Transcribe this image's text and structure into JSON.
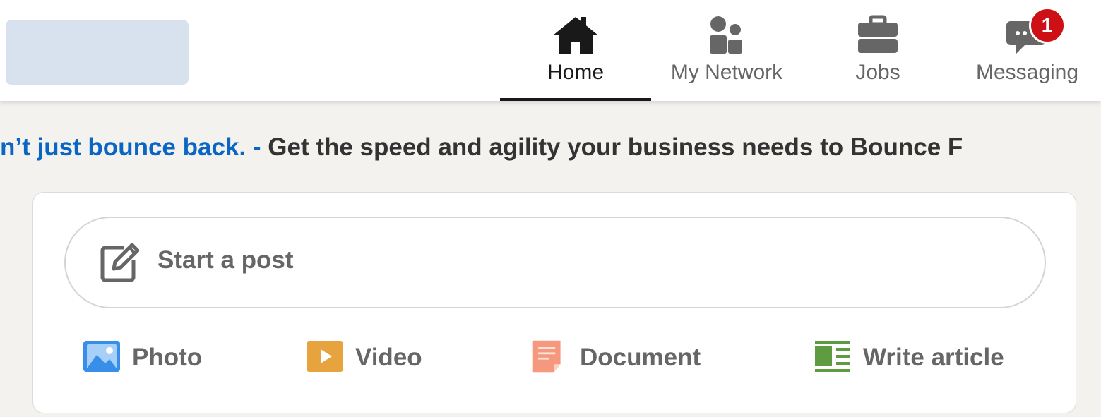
{
  "nav": {
    "items": [
      {
        "label": "Home",
        "icon": "home-icon",
        "active": true
      },
      {
        "label": "My Network",
        "icon": "people-icon",
        "active": false
      },
      {
        "label": "Jobs",
        "icon": "briefcase-icon",
        "active": false
      },
      {
        "label": "Messaging",
        "icon": "chat-icon",
        "active": false,
        "badge": "1"
      }
    ]
  },
  "ad": {
    "link_text": "n’t just bounce back.",
    "separator": " - ",
    "body_text": "Get the speed and agility your business needs to Bounce F"
  },
  "share_box": {
    "start_post_label": "Start a post",
    "actions": [
      {
        "label": "Photo",
        "icon": "photo-icon",
        "color": "#378fe9"
      },
      {
        "label": "Video",
        "icon": "video-icon",
        "color": "#e7a33e"
      },
      {
        "label": "Document",
        "icon": "document-icon",
        "color": "#f5987e"
      },
      {
        "label": "Write article",
        "icon": "article-icon",
        "color": "#5f9b41"
      }
    ]
  },
  "colors": {
    "accent": "#0a66c2",
    "badge": "#cc1016",
    "background": "#f3f2ef"
  }
}
